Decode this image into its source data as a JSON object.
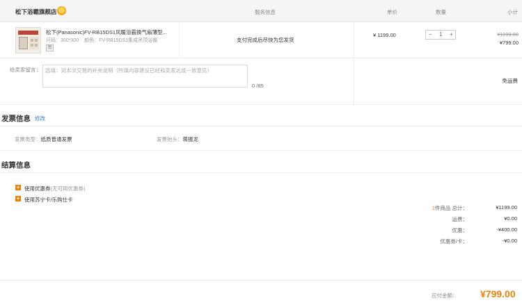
{
  "header": {
    "shop_name": "松下浴霸旗舰店",
    "col_service": "服务信息",
    "col_price": "单价",
    "col_qty": "数量",
    "col_subtotal": "小计"
  },
  "item": {
    "name": "松下(Panasonic)FV-RB15DS1风暖浴霸换气扇薄型...",
    "spec_size_label": "尺码：",
    "spec_size": "300*300",
    "spec_color_label": "颜色：",
    "spec_color": "FV-RB15DS1集成吊顶浴霸",
    "spec_tag": "图",
    "service": "支付完成后尽快为您发货",
    "price": "¥ 1199.00",
    "qty_minus": "−",
    "qty": "1",
    "qty_plus": "+",
    "original_subtotal": "¥1199.00",
    "subtotal": "¥799.00"
  },
  "message": {
    "label": "给卖家留言：",
    "placeholder": "选填：对本次交易的补充说明（所填内容建议已经和卖家达成一致意见）",
    "count": "0 /85",
    "shipping": "免运费"
  },
  "invoice": {
    "title": "发票信息",
    "edit": "修改",
    "type_label": "发票类型：",
    "type_value": "纸质普通发票",
    "header_label": "发票抬头：",
    "header_value": "蒋振龙"
  },
  "settlement": {
    "title": "结算信息",
    "coupon_icon": "plus-square-icon",
    "coupon_label": "使用优惠券",
    "coupon_note": "(无可用优惠券)",
    "card_label": "使用苏宁卡/乐购仕卡",
    "summary": [
      {
        "count": "1",
        "label": "件商品 总计：",
        "value": "¥1199.00"
      },
      {
        "count": "",
        "label": "运费：",
        "value": "¥0.00"
      },
      {
        "count": "",
        "label": "优惠：",
        "value": "-¥400.00"
      },
      {
        "count": "",
        "label": "优惠券/卡：",
        "value": "-¥0.00"
      }
    ],
    "pay_label": "应付金额：",
    "pay_amount": "¥799.00"
  },
  "colors": {
    "accent": "#e5830b",
    "link": "#3a7bd5"
  }
}
